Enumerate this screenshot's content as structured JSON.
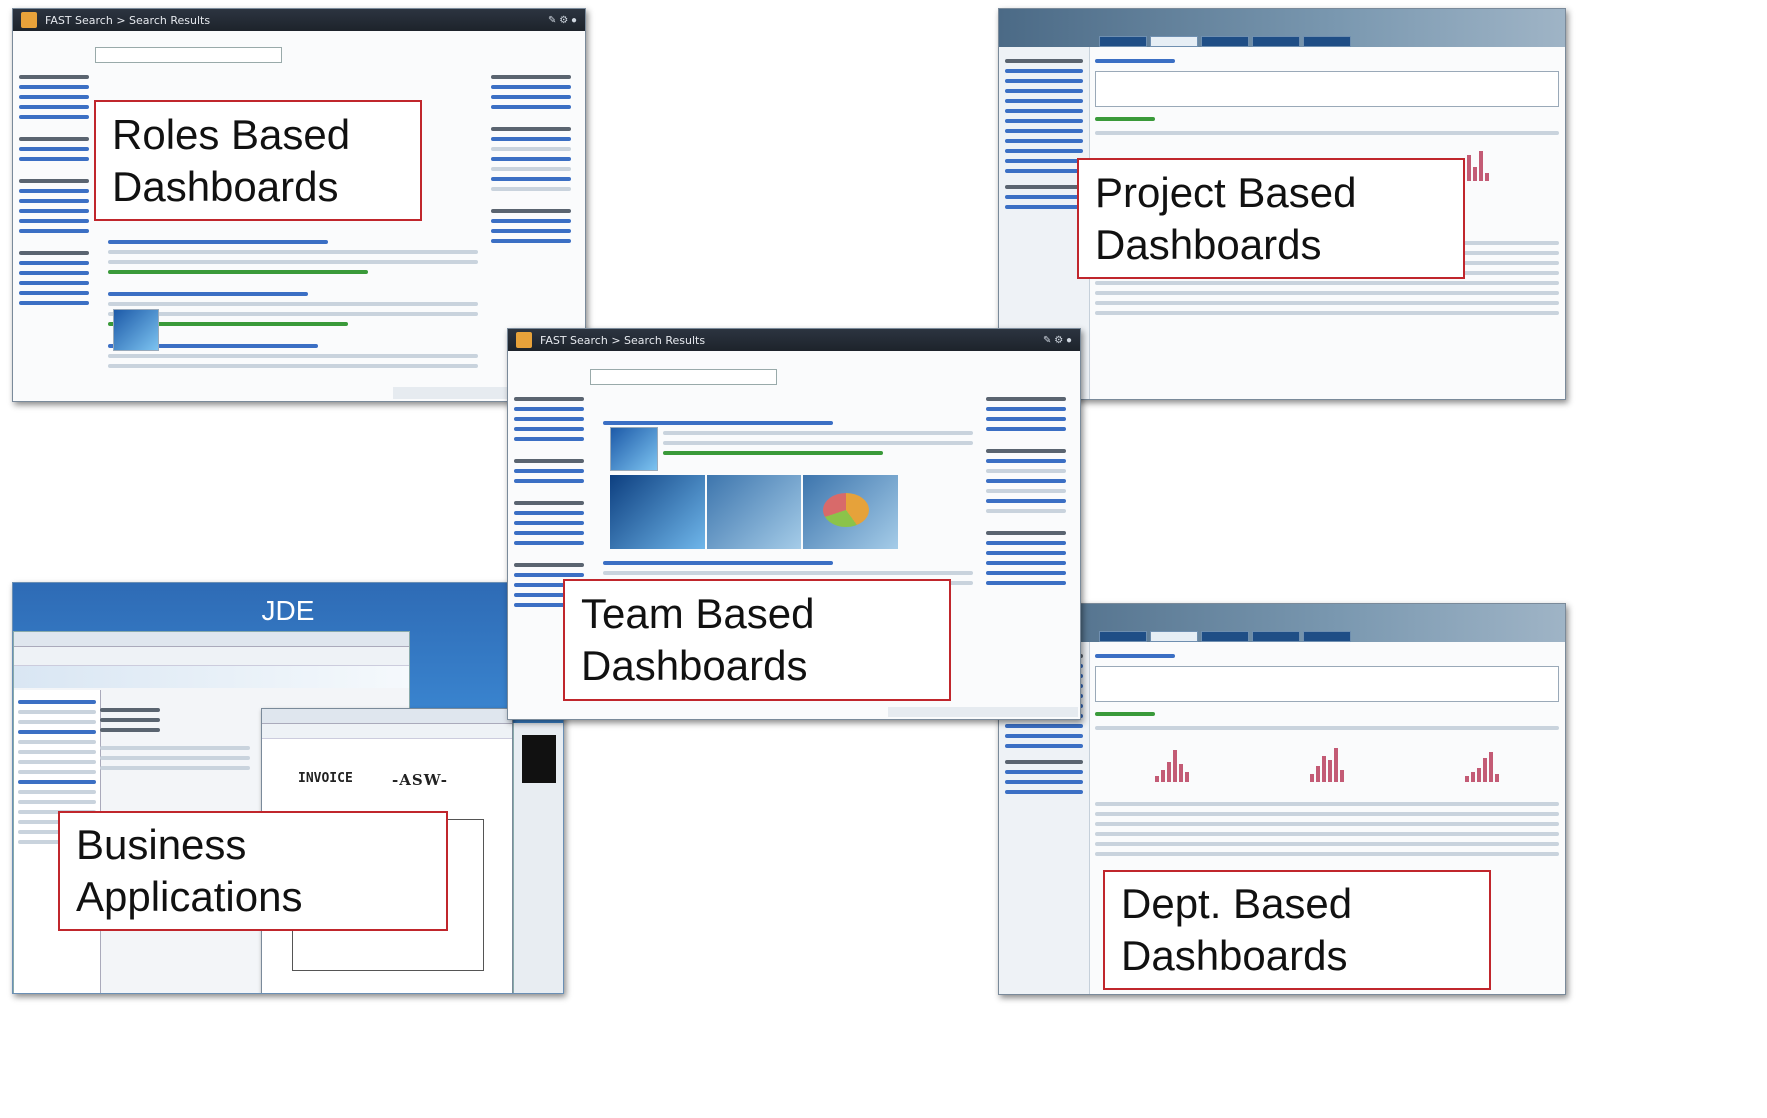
{
  "search_window_1": {
    "title": "FAST Search > Search Results"
  },
  "search_window_2": {
    "title": "FAST Search > Search Results"
  },
  "jde": {
    "title": "JDE",
    "invoice_label": "INVOICE",
    "logo_text": "-ASW-"
  },
  "labels": {
    "roles": [
      "Roles Based",
      "Dashboards"
    ],
    "project": [
      "Project Based",
      "Dashboards"
    ],
    "team": [
      "Team Based",
      "Dashboards"
    ],
    "business": [
      "Business",
      "Applications"
    ],
    "dept": [
      "Dept. Based",
      "Dashboards"
    ]
  },
  "colors": {
    "frame_border": "#7a8a9a",
    "label_border": "#c0262c",
    "jde_blue": "#2e6bb5",
    "link_blue": "#3b6fc4",
    "green_text": "#3a9a3a"
  }
}
